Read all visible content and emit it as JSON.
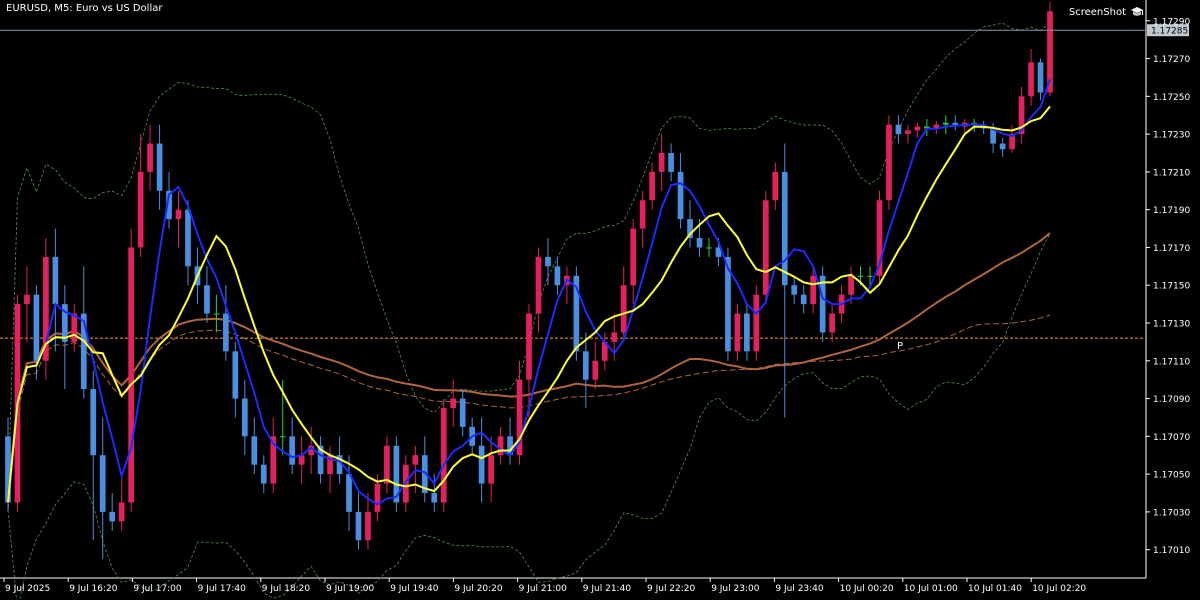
{
  "window": {
    "title": "EURUSD, M5:  Euro vs US Dollar",
    "screenshot_label": "ScreenShot"
  },
  "chart_data": {
    "type": "candlestick",
    "symbol": "EURUSD",
    "timeframe": "M5",
    "description": "Euro vs US Dollar",
    "y_axis": {
      "ticks": [
        "1.17290",
        "1.17270",
        "1.17250",
        "1.17230",
        "1.17210",
        "1.17190",
        "1.17170",
        "1.17150",
        "1.17130",
        "1.17110",
        "1.17090",
        "1.17070",
        "1.17050",
        "1.17030",
        "1.17010"
      ],
      "range": [
        1.16995,
        1.17301
      ]
    },
    "x_axis": {
      "ticks": [
        "9 Jul 2025",
        "9 Jul 16:20",
        "9 Jul 17:00",
        "9 Jul 17:40",
        "9 Jul 18:20",
        "9 Jul 19:00",
        "9 Jul 19:40",
        "9 Jul 20:20",
        "9 Jul 21:00",
        "9 Jul 21:40",
        "9 Jul 22:20",
        "9 Jul 23:00",
        "9 Jul 23:40",
        "10 Jul 00:20",
        "10 Jul 01:00",
        "10 Jul 01:40",
        "10 Jul 02:20"
      ]
    },
    "current_price": "1.17285",
    "pivot_level": 1.17122,
    "pivot_label": "P",
    "candles": [
      [
        1.1707,
        1.1708,
        1.1703,
        1.17035
      ],
      [
        1.17035,
        1.17145,
        1.1703,
        1.1714
      ],
      [
        1.1714,
        1.1716,
        1.1712,
        1.17145
      ],
      [
        1.17145,
        1.1715,
        1.171,
        1.1711
      ],
      [
        1.1711,
        1.17175,
        1.171,
        1.17165
      ],
      [
        1.17165,
        1.1718,
        1.17115,
        1.1714
      ],
      [
        1.1714,
        1.1715,
        1.17095,
        1.1712
      ],
      [
        1.1712,
        1.1714,
        1.17115,
        1.17135
      ],
      [
        1.17135,
        1.1716,
        1.1709,
        1.17095
      ],
      [
        1.17095,
        1.17105,
        1.17015,
        1.1706
      ],
      [
        1.1706,
        1.1708,
        1.17005,
        1.1703
      ],
      [
        1.1703,
        1.1704,
        1.1702,
        1.17025
      ],
      [
        1.17025,
        1.1705,
        1.1702,
        1.17035
      ],
      [
        1.17035,
        1.1718,
        1.1703,
        1.1717
      ],
      [
        1.1717,
        1.1723,
        1.17165,
        1.1721
      ],
      [
        1.1721,
        1.17235,
        1.172,
        1.17225
      ],
      [
        1.17225,
        1.17235,
        1.1719,
        1.172
      ],
      [
        1.172,
        1.1721,
        1.1718,
        1.17185
      ],
      [
        1.17185,
        1.172,
        1.1717,
        1.1719
      ],
      [
        1.1719,
        1.17195,
        1.1715,
        1.1716
      ],
      [
        1.1716,
        1.1717,
        1.1714,
        1.1715
      ],
      [
        1.1715,
        1.1716,
        1.1713,
        1.17135
      ],
      [
        1.17135,
        1.17145,
        1.17125,
        1.17135
      ],
      [
        1.17135,
        1.1715,
        1.1711,
        1.17115
      ],
      [
        1.17115,
        1.1712,
        1.1708,
        1.1709
      ],
      [
        1.1709,
        1.171,
        1.1706,
        1.1707
      ],
      [
        1.1707,
        1.1708,
        1.1705,
        1.17055
      ],
      [
        1.17055,
        1.1706,
        1.1704,
        1.17045
      ],
      [
        1.17045,
        1.1708,
        1.1704,
        1.1707
      ],
      [
        1.1707,
        1.171,
        1.1706,
        1.1707
      ],
      [
        1.1707,
        1.1708,
        1.1705,
        1.17055
      ],
      [
        1.17055,
        1.1707,
        1.17045,
        1.1706
      ],
      [
        1.1706,
        1.17075,
        1.1705,
        1.17065
      ],
      [
        1.17065,
        1.1707,
        1.17045,
        1.1705
      ],
      [
        1.1705,
        1.17065,
        1.1704,
        1.1706
      ],
      [
        1.1706,
        1.1707,
        1.17045,
        1.1705
      ],
      [
        1.1705,
        1.1706,
        1.1702,
        1.1703
      ],
      [
        1.1703,
        1.1704,
        1.1701,
        1.17015
      ],
      [
        1.17015,
        1.1704,
        1.1701,
        1.1703
      ],
      [
        1.1703,
        1.1705,
        1.17025,
        1.17045
      ],
      [
        1.17045,
        1.1707,
        1.1704,
        1.17065
      ],
      [
        1.17065,
        1.1707,
        1.1703,
        1.17035
      ],
      [
        1.17035,
        1.1706,
        1.1703,
        1.17055
      ],
      [
        1.17055,
        1.17065,
        1.1704,
        1.1706
      ],
      [
        1.1706,
        1.1707,
        1.17035,
        1.1704
      ],
      [
        1.1704,
        1.1705,
        1.1703,
        1.17035
      ],
      [
        1.17035,
        1.1709,
        1.1703,
        1.17085
      ],
      [
        1.17085,
        1.171,
        1.17075,
        1.1709
      ],
      [
        1.1709,
        1.17095,
        1.1707,
        1.17075
      ],
      [
        1.17075,
        1.1708,
        1.1706,
        1.17065
      ],
      [
        1.17065,
        1.1708,
        1.17035,
        1.17045
      ],
      [
        1.17045,
        1.1707,
        1.17035,
        1.1706
      ],
      [
        1.1706,
        1.17075,
        1.17055,
        1.1707
      ],
      [
        1.1707,
        1.1708,
        1.17055,
        1.1706
      ],
      [
        1.1706,
        1.1711,
        1.17055,
        1.171
      ],
      [
        1.171,
        1.1714,
        1.1708,
        1.17135
      ],
      [
        1.17135,
        1.1717,
        1.17125,
        1.17165
      ],
      [
        1.17165,
        1.17175,
        1.1715,
        1.1716
      ],
      [
        1.1716,
        1.17165,
        1.17145,
        1.1715
      ],
      [
        1.1715,
        1.1716,
        1.1714,
        1.17155
      ],
      [
        1.17155,
        1.1716,
        1.1711,
        1.17115
      ],
      [
        1.17115,
        1.17125,
        1.17085,
        1.171
      ],
      [
        1.171,
        1.1712,
        1.17095,
        1.1711
      ],
      [
        1.1711,
        1.17125,
        1.17105,
        1.1712
      ],
      [
        1.1712,
        1.17135,
        1.1711,
        1.17125
      ],
      [
        1.17125,
        1.1716,
        1.1712,
        1.1715
      ],
      [
        1.1715,
        1.17185,
        1.1714,
        1.1718
      ],
      [
        1.1718,
        1.172,
        1.1717,
        1.17195
      ],
      [
        1.17195,
        1.17215,
        1.1719,
        1.1721
      ],
      [
        1.1721,
        1.1723,
        1.172,
        1.1722
      ],
      [
        1.1722,
        1.17225,
        1.17205,
        1.1721
      ],
      [
        1.1721,
        1.1722,
        1.1718,
        1.17185
      ],
      [
        1.17185,
        1.17195,
        1.1717,
        1.17175
      ],
      [
        1.17175,
        1.17185,
        1.17165,
        1.1717
      ],
      [
        1.1717,
        1.17175,
        1.17165,
        1.1717
      ],
      [
        1.1717,
        1.17175,
        1.1716,
        1.17165
      ],
      [
        1.17165,
        1.1717,
        1.1711,
        1.17115
      ],
      [
        1.17115,
        1.1714,
        1.1711,
        1.17135
      ],
      [
        1.17135,
        1.1714,
        1.1711,
        1.17115
      ],
      [
        1.17115,
        1.1715,
        1.1711,
        1.17145
      ],
      [
        1.17145,
        1.172,
        1.1714,
        1.17195
      ],
      [
        1.17195,
        1.17215,
        1.1719,
        1.1721
      ],
      [
        1.1721,
        1.17225,
        1.1708,
        1.1715
      ],
      [
        1.1715,
        1.17155,
        1.1714,
        1.17145
      ],
      [
        1.17145,
        1.1715,
        1.17135,
        1.1714
      ],
      [
        1.1714,
        1.1716,
        1.17135,
        1.17155
      ],
      [
        1.17155,
        1.1716,
        1.1712,
        1.17125
      ],
      [
        1.17125,
        1.1714,
        1.1712,
        1.17135
      ],
      [
        1.17135,
        1.1715,
        1.1713,
        1.17145
      ],
      [
        1.17145,
        1.1716,
        1.1714,
        1.17155
      ],
      [
        1.17155,
        1.1716,
        1.1715,
        1.17155
      ],
      [
        1.17155,
        1.1716,
        1.1715,
        1.17155
      ],
      [
        1.17155,
        1.172,
        1.1715,
        1.17195
      ],
      [
        1.17195,
        1.1724,
        1.1719,
        1.17235
      ],
      [
        1.17235,
        1.1724,
        1.17225,
        1.1723
      ],
      [
        1.1723,
        1.17235,
        1.17225,
        1.17232
      ],
      [
        1.17232,
        1.17236,
        1.17228,
        1.17234
      ],
      [
        1.17234,
        1.17238,
        1.17229,
        1.17233
      ],
      [
        1.17233,
        1.17237,
        1.1723,
        1.17235
      ],
      [
        1.17235,
        1.1724,
        1.1723,
        1.17236
      ],
      [
        1.17236,
        1.1724,
        1.17232,
        1.17234
      ],
      [
        1.17234,
        1.17238,
        1.1723,
        1.17236
      ],
      [
        1.17236,
        1.17238,
        1.17231,
        1.17235
      ],
      [
        1.17235,
        1.17237,
        1.1723,
        1.17233
      ],
      [
        1.17233,
        1.17236,
        1.1722,
        1.17225
      ],
      [
        1.17225,
        1.17228,
        1.17218,
        1.17222
      ],
      [
        1.17222,
        1.17235,
        1.1722,
        1.1723
      ],
      [
        1.1723,
        1.17255,
        1.17225,
        1.1725
      ],
      [
        1.1725,
        1.17275,
        1.17245,
        1.17268
      ],
      [
        1.17268,
        1.1727,
        1.17248,
        1.17252
      ],
      [
        1.17252,
        1.173,
        1.1725,
        1.17295
      ]
    ],
    "colors": {
      "background": "#000000",
      "bull": "#e4215d",
      "bear": "#4a90e2",
      "doji": "#2fcf3a",
      "ma_fast": "#1a2cff",
      "ma_slow": "#ffff33",
      "ma_long_solid": "#b0653a",
      "ma_long_dashed": "#b0653a",
      "bands": "#4f8f4f",
      "pivot": "#ff9f1a",
      "axis": "#ffffff",
      "price_line": "#8899aa"
    }
  }
}
